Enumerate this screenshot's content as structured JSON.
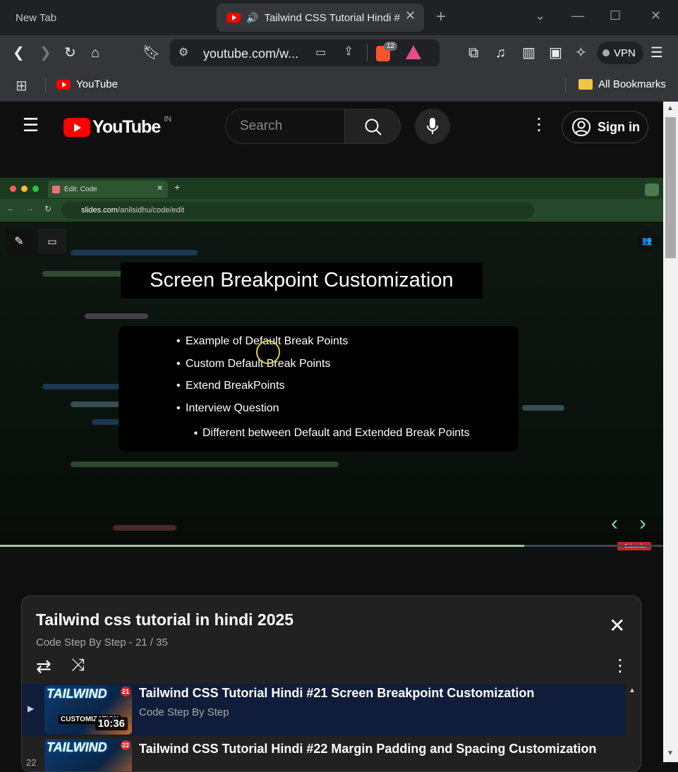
{
  "browser": {
    "tabs": [
      {
        "label": "New Tab"
      },
      {
        "label": "Tailwind CSS Tutorial Hindi #"
      }
    ],
    "address": "youtube.com/w...",
    "shield_count": "12",
    "vpn_label": "VPN",
    "bookmarks": {
      "youtube": "YouTube",
      "all": "All Bookmarks"
    }
  },
  "youtube": {
    "logo_text": "YouTube",
    "region": "IN",
    "search_placeholder": "Search",
    "signin_label": "Sign in"
  },
  "video": {
    "inner_tab_label": "Edit: Code",
    "inner_url_domain": "slides.com",
    "inner_url_path": "/anilsidhu/code/edit",
    "slide_title": "Screen Breakpoint Customization",
    "bullets": [
      "Example of Default Break Points",
      "Custom Default Break Points",
      "Extend BreakPoints",
      "Interview Question"
    ],
    "sub_bullet": "Different between Default and Extended Break Points",
    "subscribe_label": "Subscribe",
    "progress": 0.79
  },
  "playlist": {
    "title": "Tailwind css tutorial in hindi 2025",
    "channel": "Code Step By Step",
    "position": "21 / 35",
    "items": [
      {
        "thumb_text": "TAILWIND",
        "thumb_badge": "21",
        "thumb_sub": "CUSTOMIZATION",
        "duration": "10:36",
        "title": "Tailwind CSS Tutorial Hindi #21 Screen Breakpoint Customization",
        "channel": "Code Step By Step"
      },
      {
        "thumb_text": "TAILWIND",
        "thumb_badge": "22",
        "index": "22",
        "title": "Tailwind CSS Tutorial Hindi #22 Margin Padding and Spacing Customization"
      }
    ]
  }
}
